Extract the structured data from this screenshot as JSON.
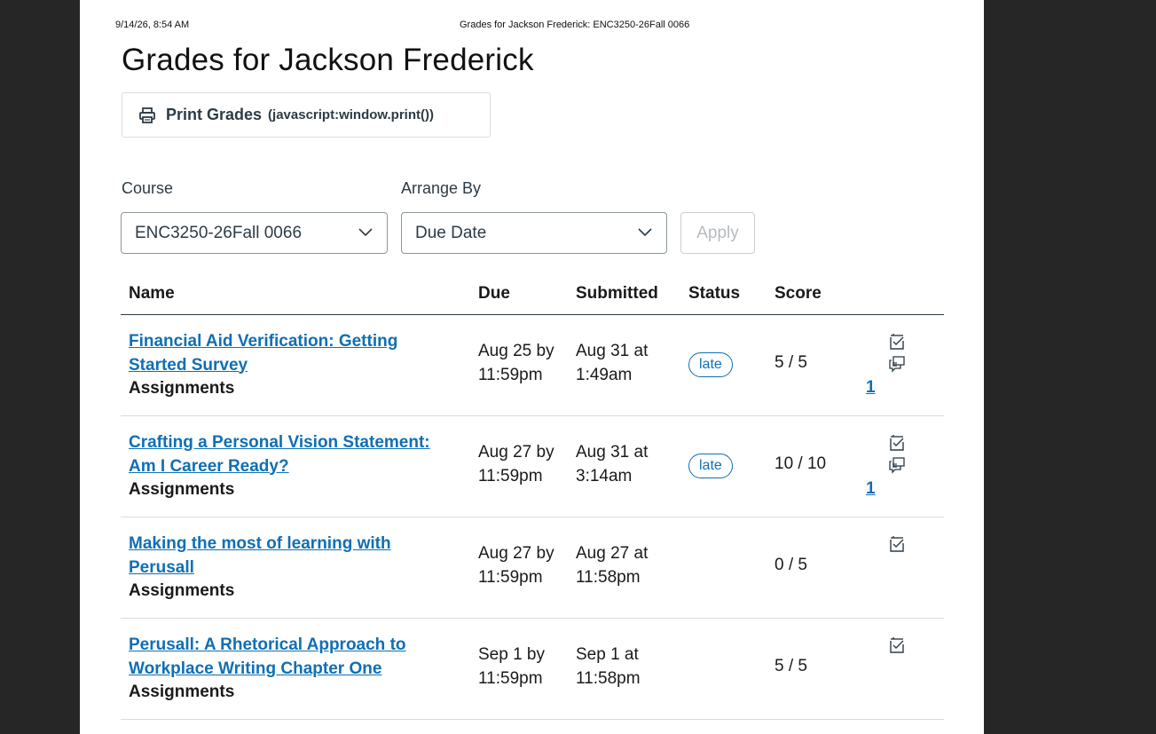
{
  "print_header": {
    "date": "9/14/26, 8:54 AM",
    "title": "Grades for Jackson Frederick: ENC3250-26Fall 0066"
  },
  "page_title": "Grades for Jackson Frederick",
  "print_button": {
    "label": "Print Grades",
    "url": "(javascript:window.print())",
    "icon": "printer-icon"
  },
  "filters": {
    "course_label": "Course",
    "course_value": "ENC3250-26Fall 0066",
    "arrange_label": "Arrange By",
    "arrange_value": "Due Date",
    "apply_label": "Apply"
  },
  "table": {
    "headers": {
      "name": "Name",
      "due": "Due",
      "submitted": "Submitted",
      "status": "Status",
      "score": "Score"
    },
    "rows": [
      {
        "link_line1": "Financial Aid Verification: Getting",
        "link_line2": "Started Survey",
        "type": "Assignments",
        "due_line1": "Aug 25 by",
        "due_line2": "11:59pm",
        "sub_line1": "Aug 31 at",
        "sub_line2": "1:49am",
        "status": "late",
        "score": "5 / 5",
        "comment_count": "1"
      },
      {
        "link_line1": "Crafting a Personal Vision Statement:",
        "link_line2": "Am I Career Ready?",
        "type": "Assignments",
        "due_line1": "Aug 27 by",
        "due_line2": "11:59pm",
        "sub_line1": "Aug 31 at",
        "sub_line2": "3:14am",
        "status": "late",
        "score": "10 / 10",
        "comment_count": "1"
      },
      {
        "link_line1": "Making the most of learning with",
        "link_line2": "Perusall",
        "type": "Assignments",
        "due_line1": "Aug 27 by",
        "due_line2": "11:59pm",
        "sub_line1": "Aug 27 at",
        "sub_line2": "11:58pm",
        "status": "",
        "score": "0 / 5",
        "comment_count": ""
      },
      {
        "link_line1": "Perusall: A Rhetorical Approach to",
        "link_line2": "Workplace Writing Chapter One",
        "type": "Assignments",
        "due_line1": "Sep 1 by",
        "due_line2": "11:59pm",
        "sub_line1": "Sep 1 at",
        "sub_line2": "11:58pm",
        "status": "",
        "score": "5 / 5",
        "comment_count": ""
      }
    ]
  },
  "colors": {
    "link": "#0f6fb5",
    "text": "#2d3b45",
    "backdrop": "#262626"
  }
}
